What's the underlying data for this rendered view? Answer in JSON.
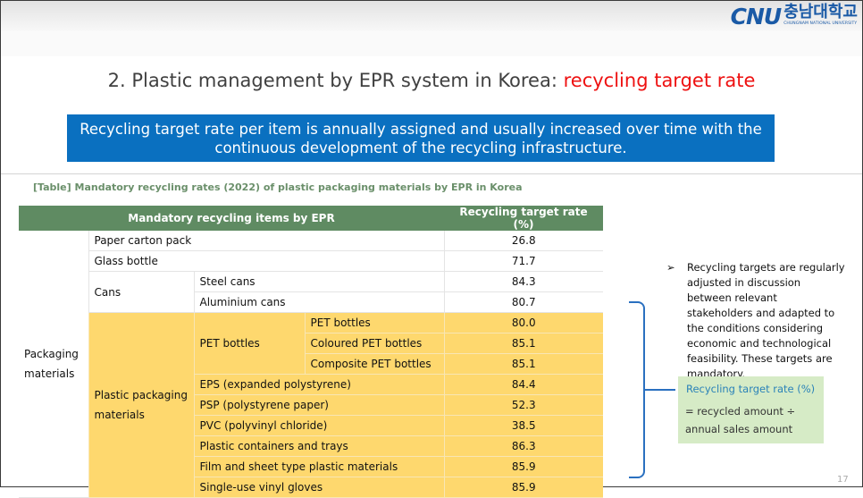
{
  "logo": {
    "brand": "CNU",
    "korean": "충남대학교",
    "sub": "CHUNGNAM NATIONAL UNIVERSITY"
  },
  "title": {
    "prefix": "2. Plastic management by EPR system in Korea: ",
    "highlight": "recycling target rate"
  },
  "banner": "Recycling target rate per item is annually assigned and usually increased over time with the continuous development of the recycling infrastructure.",
  "table": {
    "caption": "[Table] Mandatory recycling rates (2022) of plastic packaging materials by EPR in Korea",
    "headers": {
      "items": "Mandatory recycling items by EPR",
      "rate": "Recycling target  rate (%)"
    },
    "group_label": "Packaging materials",
    "rows": {
      "paper_carton": {
        "label": "Paper carton pack",
        "rate": "26.8"
      },
      "glass_bottle": {
        "label": "Glass bottle",
        "rate": "71.7"
      },
      "cans": {
        "label": "Cans",
        "steel": {
          "label": "Steel cans",
          "rate": "84.3"
        },
        "aluminium": {
          "label": "Aluminium cans",
          "rate": "80.7"
        }
      },
      "plastic": {
        "label": "Plastic packaging materials",
        "pet": {
          "label": "PET bottles",
          "items": [
            {
              "label": "PET bottles",
              "rate": "80.0"
            },
            {
              "label": "Coloured PET bottles",
              "rate": "85.1"
            },
            {
              "label": "Composite PET bottles",
              "rate": "85.1"
            }
          ]
        },
        "others": [
          {
            "label": "EPS (expanded polystyrene)",
            "rate": "84.4"
          },
          {
            "label": "PSP (polystyrene paper)",
            "rate": "52.3"
          },
          {
            "label": "PVC (polyvinyl chloride)",
            "rate": "38.5"
          },
          {
            "label": "Plastic containers and trays",
            "rate": "86.3"
          },
          {
            "label": "Film and sheet type plastic materials",
            "rate": "85.9"
          },
          {
            "label": "Single-use vinyl gloves",
            "rate": "85.9"
          }
        ]
      }
    }
  },
  "notes": {
    "bullet": "➢",
    "text": "Recycling targets are regularly adjusted in discussion between relevant stakeholders and adapted to the conditions considering economic and technological feasibility. These targets are mandatory."
  },
  "formula": {
    "title": "Recycling target rate (%)",
    "line1": "= recycled amount ÷",
    "line2": "annual sales amount"
  },
  "page_number": "17",
  "colors": {
    "banner": "#0a70c0",
    "table_header": "#5f8b62",
    "highlight_rows": "#fed86e",
    "title_accent": "#ee1111",
    "formula_box": "#d6ebc6",
    "bracket": "#2a70c0"
  }
}
